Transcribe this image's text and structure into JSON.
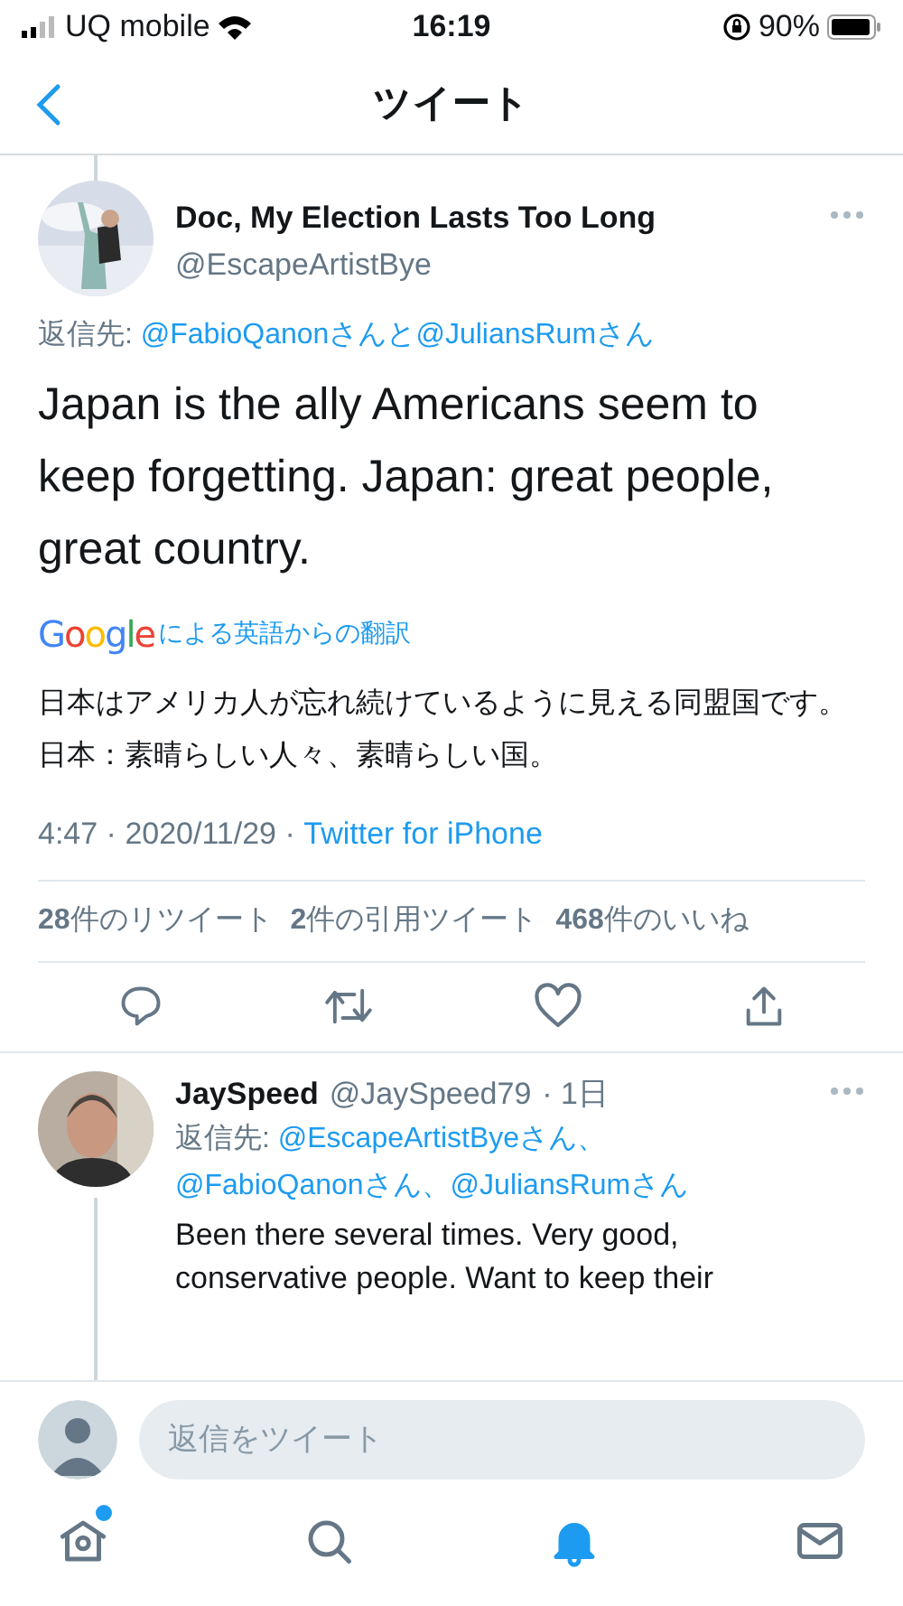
{
  "status_bar": {
    "carrier": "UQ mobile",
    "time": "16:19",
    "battery": "90%"
  },
  "header": {
    "title": "ツイート"
  },
  "tweet": {
    "name": "Doc, My Election Lasts Too Long",
    "handle": "@EscapeArtistBye",
    "reply_label": "返信先: ",
    "reply_to": "@FabioQanonさんと@JuliansRumさん",
    "text": "Japan is the ally Americans seem to keep forgetting. Japan: great people, great country.",
    "translation": {
      "logo": "Google",
      "label": "による英語からの翻訳",
      "text": "日本はアメリカ人が忘れ続けているように見える同盟国です。日本：素晴らしい人々、素晴らしい国。"
    },
    "time": "4:47 · 2020/11/29 · ",
    "source": "Twitter for iPhone",
    "stats": [
      "**28**件のリツイート",
      "**2**件の引用ツイート",
      "**468**件のいいね"
    ],
    "liked": false
  },
  "reply": {
    "name": "JaySpeed",
    "handle": "@JaySpeed79",
    "age": "· 1日",
    "reply_label": "返信先: ",
    "reply_to": [
      "@EscapeArtistByeさん、",
      "@FabioQanonさん、@JuliansRumさん"
    ],
    "text": "Been there several times. Very good, conservative people. Want to keep their"
  },
  "composer": {
    "placeholder": "返信をツイート"
  },
  "tab_bar": [
    {
      "kind": "home",
      "selected": false,
      "badge": true
    },
    {
      "kind": "search",
      "selected": false,
      "badge": false
    },
    {
      "kind": "notifications",
      "selected": true,
      "badge": false
    },
    {
      "kind": "messages",
      "selected": false,
      "badge": false
    }
  ]
}
